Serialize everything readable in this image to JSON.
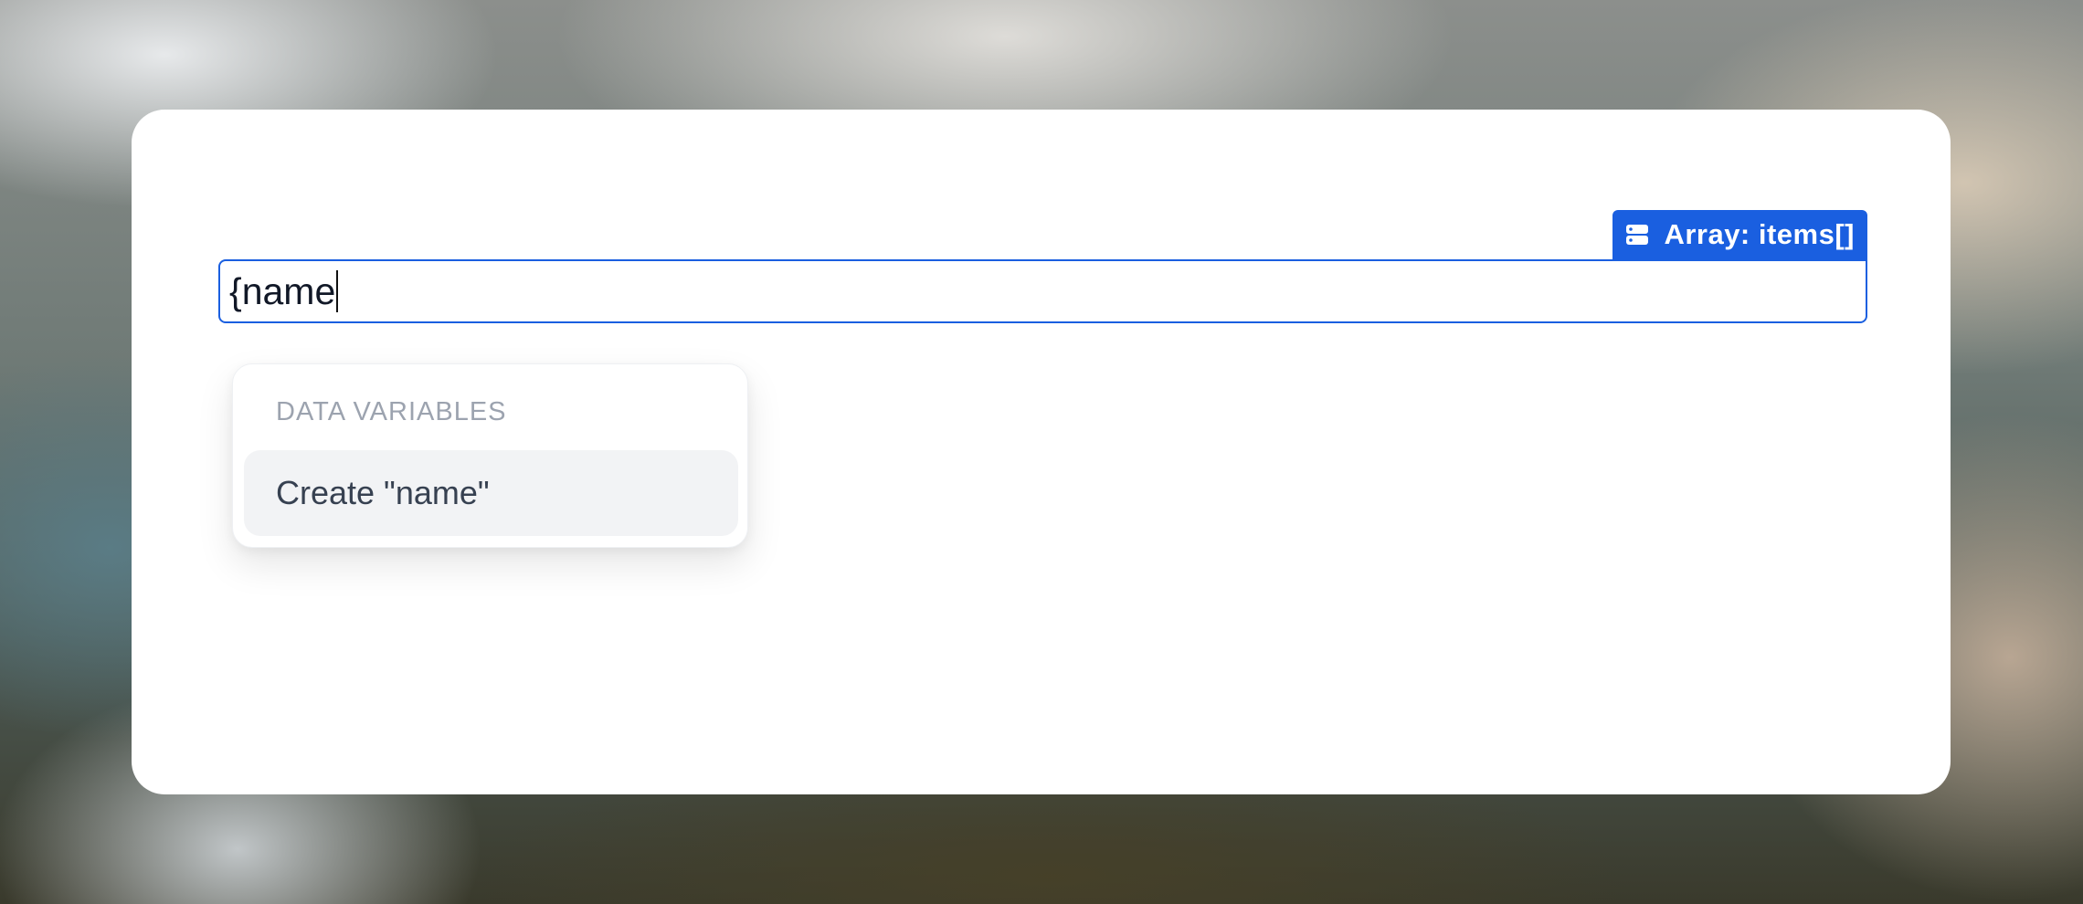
{
  "badge": {
    "icon": "database-icon",
    "label": "Array: items[]",
    "color": "#1a5fe0"
  },
  "field": {
    "value": "{name"
  },
  "dropdown": {
    "heading": "DATA VARIABLES",
    "items": [
      {
        "label": "Create \"name\"",
        "highlighted": true
      }
    ]
  }
}
